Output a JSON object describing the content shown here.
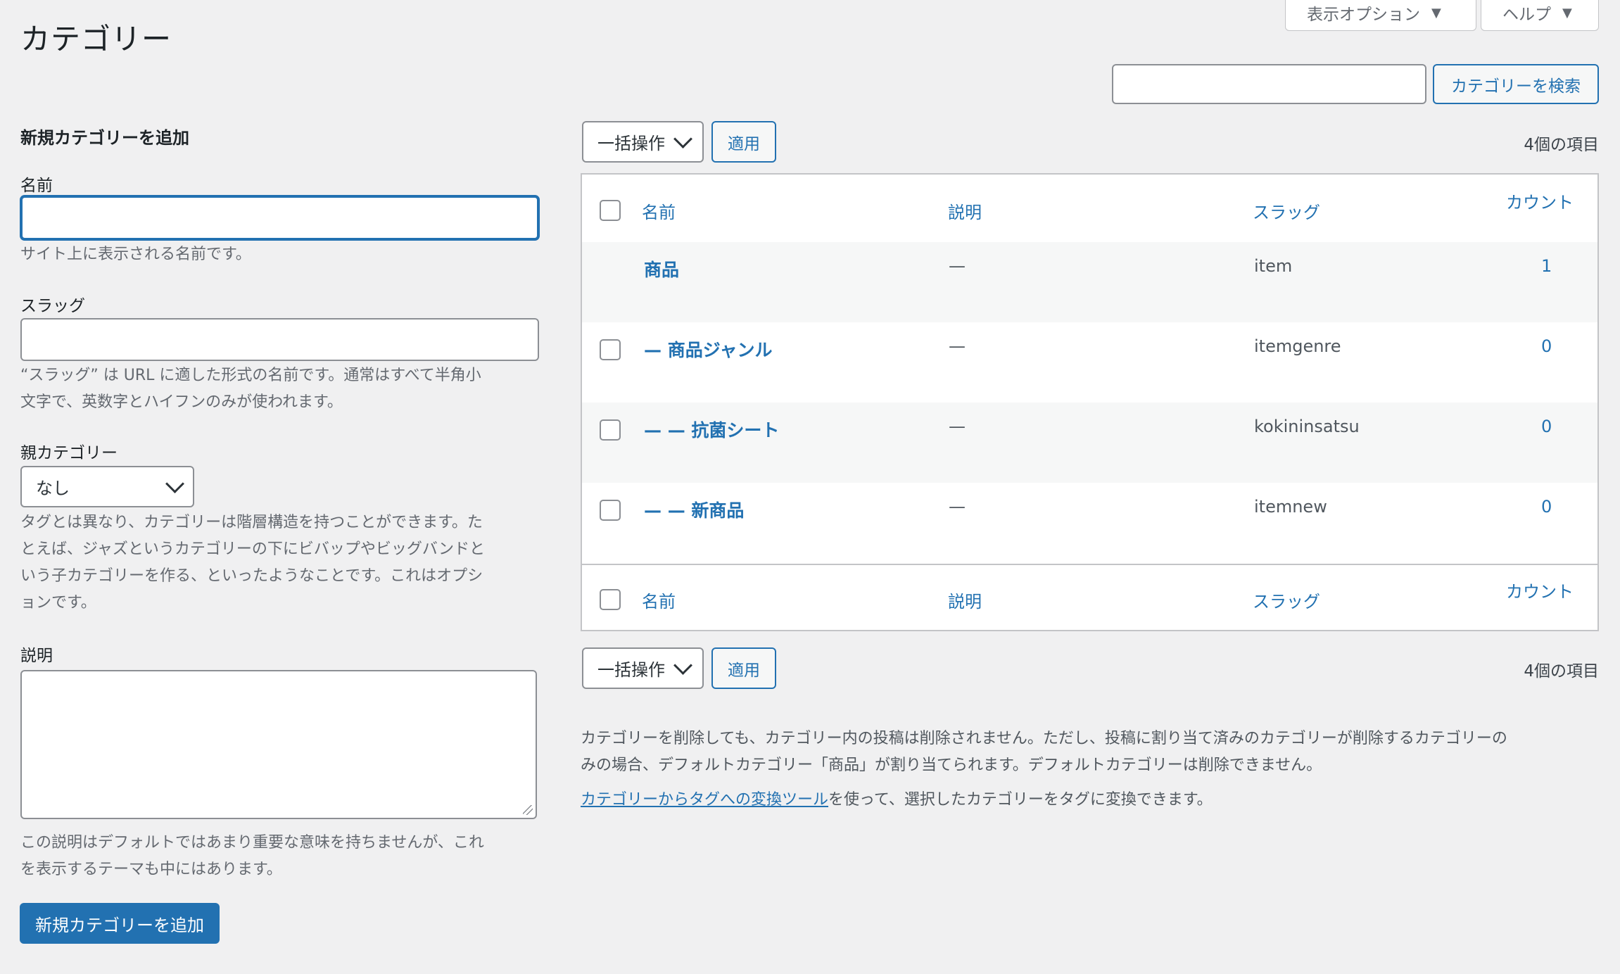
{
  "header": {
    "title": "カテゴリー",
    "screen_options": "表示オプション",
    "help": "ヘルプ"
  },
  "search": {
    "value": "",
    "button": "カテゴリーを検索"
  },
  "form": {
    "heading": "新規カテゴリーを追加",
    "name_label": "名前",
    "name_value": "",
    "name_help": "サイト上に表示される名前です。",
    "slug_label": "スラッグ",
    "slug_value": "",
    "slug_help_1": "“スラッグ” は URL に適した形式の名前です。通常はすべて半角小",
    "slug_help_2": "文字で、英数字とハイフンのみが使われます。",
    "parent_label": "親カテゴリー",
    "parent_selected": "なし",
    "parent_help_1": "タグとは異なり、カテゴリーは階層構造を持つことができます。た",
    "parent_help_2": "とえば、ジャズというカテゴリーの下にビバップやビッグバンドと",
    "parent_help_3": "いう子カテゴリーを作る、といったようなことです。これはオプシ",
    "parent_help_4": "ョンです。",
    "desc_label": "説明",
    "desc_value": "",
    "desc_help_1": "この説明はデフォルトではあまり重要な意味を持ちませんが、これ",
    "desc_help_2": "を表示するテーマも中にはあります。",
    "submit": "新規カテゴリーを追加"
  },
  "table": {
    "bulk_action": "一括操作",
    "apply": "適用",
    "items_count": "4個の項目",
    "columns": {
      "name": "名前",
      "description": "説明",
      "slug": "スラッグ",
      "count": "カウント"
    },
    "rows": [
      {
        "name": "商品",
        "description": "—",
        "slug": "item",
        "count": "1"
      },
      {
        "name": "— 商品ジャンル",
        "description": "—",
        "slug": "itemgenre",
        "count": "0"
      },
      {
        "name": "— — 抗菌シート",
        "description": "—",
        "slug": "kokininsatsu",
        "count": "0"
      },
      {
        "name": "— — 新商品",
        "description": "—",
        "slug": "itemnew",
        "count": "0"
      }
    ]
  },
  "footnote": {
    "line1": "カテゴリーを削除しても、カテゴリー内の投稿は削除されません。ただし、投稿に割り当て済みのカテゴリーが削除するカテゴリーの",
    "line2": "みの場合、デフォルトカテゴリー「商品」が割り当てられます。デフォルトカテゴリーは削除できません。",
    "link": "カテゴリーからタグへの変換ツール",
    "line3_rest": "を使って、選択したカテゴリーをタグに変換できます。"
  }
}
